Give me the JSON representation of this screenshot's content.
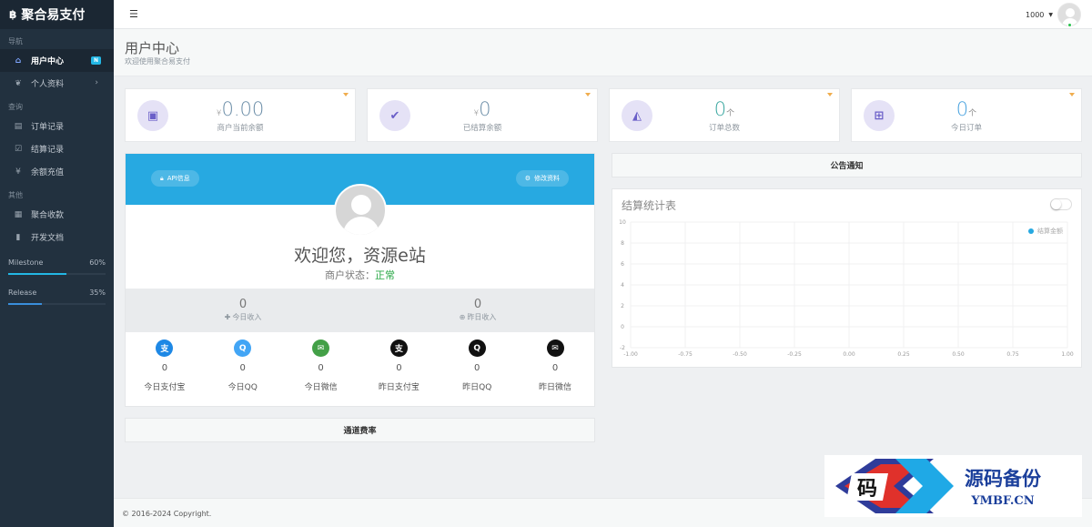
{
  "brand": {
    "logo_glyph": "฿",
    "name": "聚合易支付"
  },
  "sidebar": {
    "sections": [
      {
        "heading": "导航",
        "items": [
          {
            "icon": "home-icon",
            "glyph": "⌂",
            "label": "用户中心",
            "badge": "N",
            "active": true
          },
          {
            "icon": "leaf-icon",
            "glyph": "❦",
            "label": "个人资料",
            "chevron": "›"
          }
        ]
      },
      {
        "heading": "查询",
        "items": [
          {
            "icon": "list-icon",
            "glyph": "▤",
            "label": "订单记录"
          },
          {
            "icon": "check-square-icon",
            "glyph": "☑",
            "label": "结算记录"
          },
          {
            "icon": "yen-icon",
            "glyph": "¥",
            "label": "余额充值"
          }
        ]
      },
      {
        "heading": "其他",
        "items": [
          {
            "icon": "collect-icon",
            "glyph": "▦",
            "label": "聚合收款"
          },
          {
            "icon": "book-icon",
            "glyph": "▮",
            "label": "开发文档"
          }
        ]
      }
    ],
    "progress": [
      {
        "label": "Milestone",
        "value_text": "60%",
        "value": 0.6
      },
      {
        "label": "Release",
        "value_text": "35%",
        "value": 0.35
      }
    ]
  },
  "topbar": {
    "menu_glyph": "☰",
    "user": "1000",
    "caret": "▼"
  },
  "page": {
    "title": "用户中心",
    "subtitle": "欢迎使用聚合易支付"
  },
  "stats": [
    {
      "icon": "money-icon",
      "glyph": "▣",
      "currency": "¥",
      "value": "0.00",
      "unit": "",
      "label": "商户当前余额",
      "style": ""
    },
    {
      "icon": "check-icon",
      "glyph": "✔",
      "currency": "¥",
      "value": "0",
      "unit": "",
      "label": "已结算余额",
      "style": ""
    },
    {
      "icon": "area-chart-icon",
      "glyph": "◭",
      "currency": "",
      "value": "0",
      "unit": "个",
      "label": "订单总数",
      "style": "teal"
    },
    {
      "icon": "cart-icon",
      "glyph": "⊞",
      "currency": "",
      "value": "0",
      "unit": "个",
      "label": "今日订单",
      "style": "blue"
    }
  ],
  "profile": {
    "api_button": "API信息",
    "edit_button": "修改资料",
    "welcome": "欢迎您，资源e站",
    "status_label": "商户状态：",
    "status_value": "正常",
    "income": [
      {
        "value": "0",
        "label": "今日收入",
        "glyph": "✚"
      },
      {
        "value": "0",
        "label": "昨日收入",
        "glyph": "⊕"
      }
    ],
    "payments": [
      {
        "icon": "alipay-icon",
        "glyph": "支",
        "color": "#1e88e5",
        "value": "0",
        "label": "今日支付宝"
      },
      {
        "icon": "qq-icon",
        "glyph": "Q",
        "color": "#42a5f5",
        "value": "0",
        "label": "今日QQ"
      },
      {
        "icon": "wechat-icon",
        "glyph": "✉",
        "color": "#43a047",
        "value": "0",
        "label": "今日微信"
      },
      {
        "icon": "alipay-dark-icon",
        "glyph": "支",
        "color": "#111111",
        "value": "0",
        "label": "昨日支付宝"
      },
      {
        "icon": "qq-dark-icon",
        "glyph": "Q",
        "color": "#111111",
        "value": "0",
        "label": "昨日QQ"
      },
      {
        "icon": "wechat-dark-icon",
        "glyph": "✉",
        "color": "#111111",
        "value": "0",
        "label": "昨日微信"
      }
    ]
  },
  "rate_title": "通道费率",
  "notice_title": "公告通知",
  "chart_title": "结算统计表",
  "chart_data": {
    "type": "line",
    "series": [
      {
        "name": "结算金额",
        "values": []
      }
    ],
    "x_ticks": [
      "-1.00",
      "-0.75",
      "-0.50",
      "-0.25",
      "0.00",
      "0.25",
      "0.50",
      "0.75",
      "1.00"
    ],
    "y_ticks": [
      "10",
      "8",
      "6",
      "4",
      "2",
      "0",
      "-2"
    ],
    "xlim": [
      -1,
      1
    ],
    "ylim": [
      -2,
      10
    ],
    "grid": true,
    "legend": "top-right",
    "legend_color": "#27a9e1"
  },
  "footer": {
    "copyright": "© 2016-2024 Copyright."
  },
  "watermark": {
    "title": "源码备份",
    "domain": "YMBF.CN",
    "glyph": "码"
  }
}
